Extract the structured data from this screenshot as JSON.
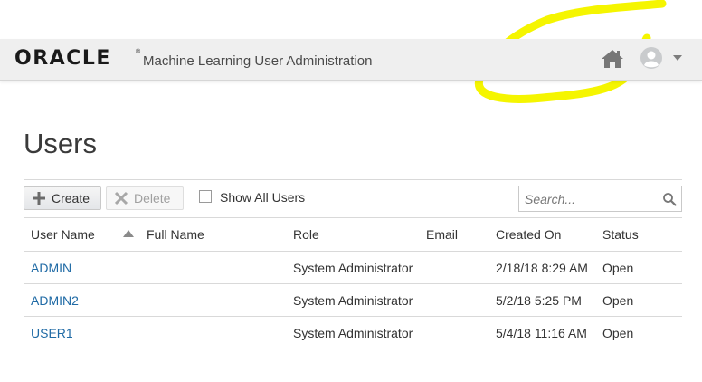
{
  "header": {
    "logo_text": "ORACLE",
    "app_title": "Machine Learning User Administration",
    "icons": [
      "home-icon",
      "avatar-icon",
      "caret-down-icon"
    ]
  },
  "page": {
    "title": "Users"
  },
  "toolbar": {
    "create_label": "Create",
    "delete_label": "Delete",
    "show_all_label": "Show All Users",
    "show_all_checked": false,
    "search_placeholder": "Search..."
  },
  "table": {
    "columns": [
      "User Name",
      "Full Name",
      "Role",
      "Email",
      "Created On",
      "Status"
    ],
    "sort_column": "User Name",
    "sort_direction": "ascending",
    "rows": [
      {
        "user_name": "ADMIN",
        "full_name": "",
        "role": "System Administrator",
        "email": "",
        "created_on": "2/18/18 8:29 AM",
        "status": "Open"
      },
      {
        "user_name": "ADMIN2",
        "full_name": "",
        "role": "System Administrator",
        "email": "",
        "created_on": "5/2/18 5:25 PM",
        "status": "Open"
      },
      {
        "user_name": "USER1",
        "full_name": "",
        "role": "System Administrator",
        "email": "",
        "created_on": "5/4/18 11:16 AM",
        "status": "Open"
      }
    ]
  },
  "colors": {
    "link": "#1f6aa5",
    "header_bg": "#efefef",
    "annotation": "#f5f500"
  }
}
